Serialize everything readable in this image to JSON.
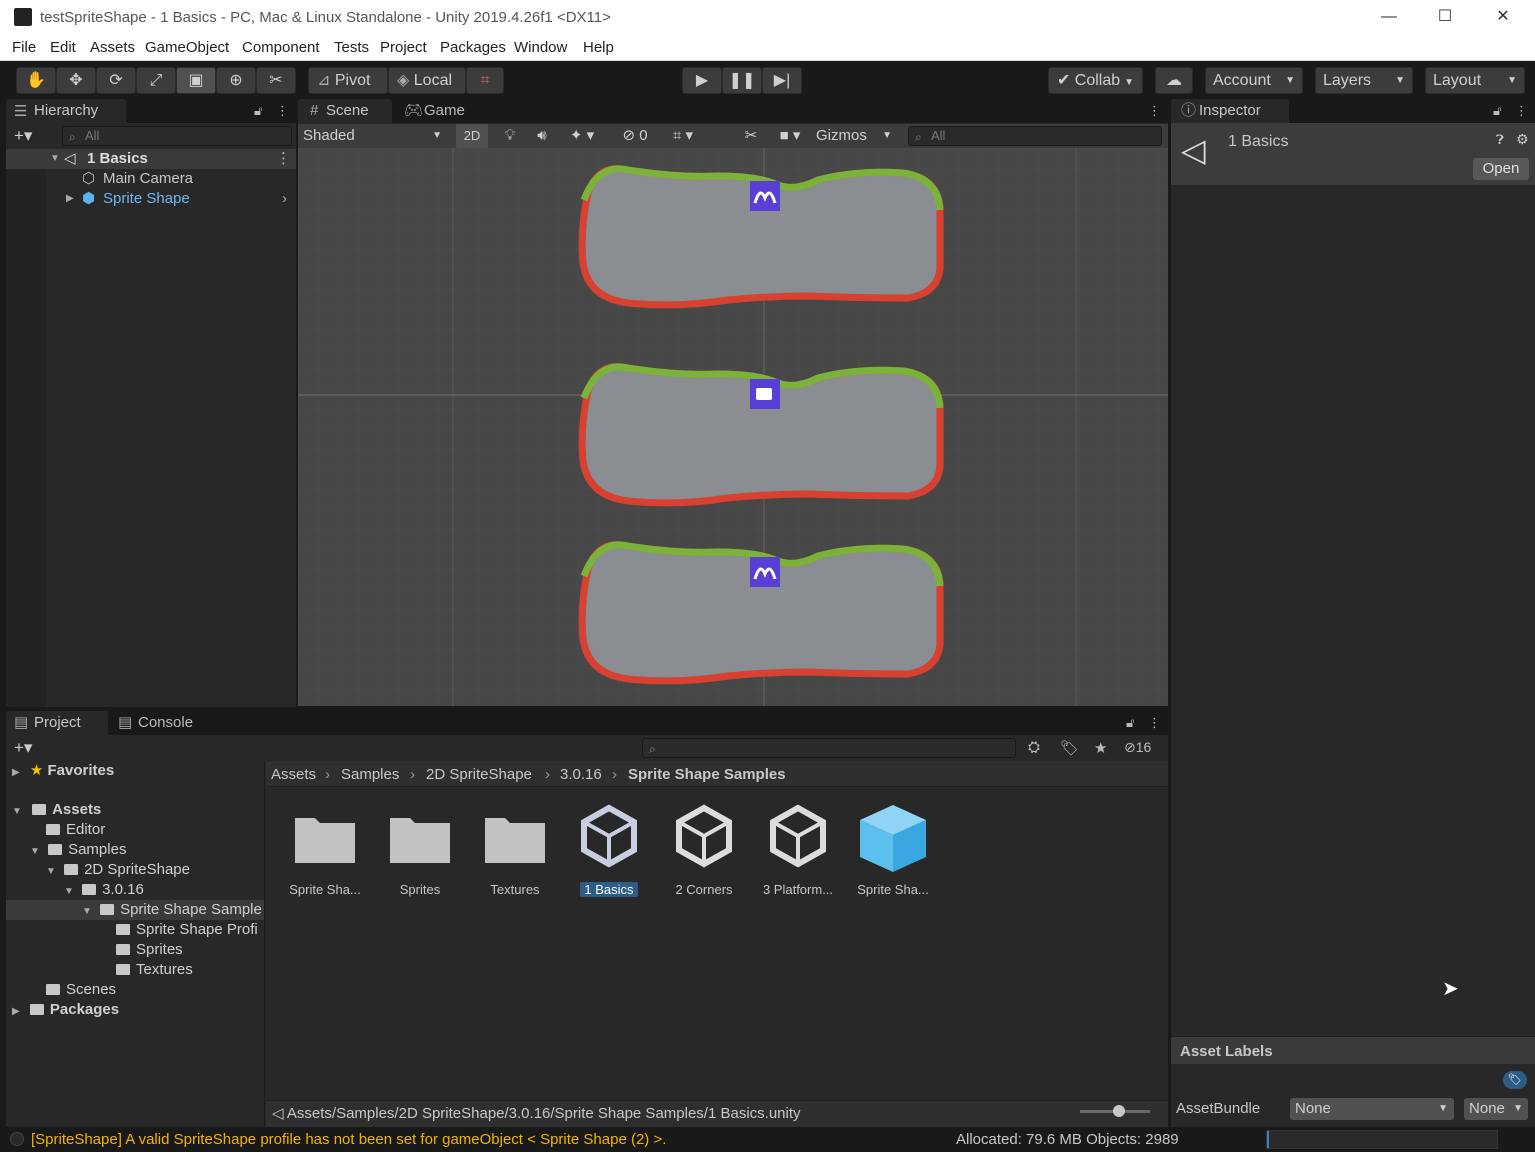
{
  "window": {
    "title": "testSpriteShape - 1 Basics - PC, Mac & Linux Standalone - Unity 2019.4.26f1 <DX11>",
    "controls": {
      "minimize": "—",
      "maximize": "☐",
      "close": "✕"
    }
  },
  "menu": [
    "File",
    "Edit",
    "Assets",
    "GameObject",
    "Component",
    "Tests",
    "Project",
    "Packages",
    "Window",
    "Help"
  ],
  "toolbar": {
    "pivot_label": "Pivot",
    "local_label": "Local",
    "collab_label": "Collab",
    "account_label": "Account",
    "layers_label": "Layers",
    "layout_label": "Layout"
  },
  "hierarchy": {
    "tab_label": "Hierarchy",
    "search_placeholder": "All",
    "scene_name": "1 Basics",
    "items": [
      "Main Camera",
      "Sprite Shape"
    ]
  },
  "scene": {
    "tabs": [
      "Scene",
      "Game"
    ],
    "shading_mode": "Shaded",
    "mode_2d": "2D",
    "hidden_count": "0",
    "gizmos_label": "Gizmos",
    "search_placeholder": "All"
  },
  "inspector": {
    "tab_label": "Inspector",
    "asset_name": "1 Basics",
    "open_button": "Open",
    "asset_labels_title": "Asset Labels",
    "assetbundle_label": "AssetBundle",
    "assetbundle_value": "None",
    "assetbundle_variant": "None"
  },
  "project": {
    "tabs": [
      "Project",
      "Console"
    ],
    "hidden_count": "16",
    "tree": {
      "favorites": "Favorites",
      "assets": "Assets",
      "editor": "Editor",
      "samples": "Samples",
      "spriteshape2d": "2D SpriteShape",
      "version": "3.0.16",
      "sprite_shape_samples": "Sprite Shape Sample",
      "sprite_shape_profiles": "Sprite Shape Profi",
      "sprites": "Sprites",
      "textures": "Textures",
      "scenes": "Scenes",
      "packages": "Packages"
    },
    "breadcrumb": [
      "Assets",
      "Samples",
      "2D SpriteShape",
      "3.0.16",
      "Sprite Shape Samples"
    ],
    "assets": [
      {
        "label": "Sprite Sha...",
        "kind": "folder"
      },
      {
        "label": "Sprites",
        "kind": "folder"
      },
      {
        "label": "Textures",
        "kind": "folder"
      },
      {
        "label": "1 Basics",
        "kind": "unity-scene",
        "selected": true
      },
      {
        "label": "2 Corners",
        "kind": "unity-scene"
      },
      {
        "label": "3 Platform...",
        "kind": "unity-scene"
      },
      {
        "label": "Sprite Sha...",
        "kind": "prefab-cube"
      }
    ],
    "path": "Assets/Samples/2D SpriteShape/3.0.16/Sprite Shape Samples/1 Basics.unity"
  },
  "status": {
    "message": "[SpriteShape] A valid SpriteShape profile has not been set for gameObject < Sprite Shape (2) >.",
    "allocated": "Allocated: 79.6 MB Objects: 2989"
  },
  "colors": {
    "accent_blue": "#2c5d87",
    "shape_top": "#7bb33a",
    "shape_bottom": "#d8402f",
    "shape_fill": "#8a8d91",
    "icon_purple": "#5a3fd6",
    "warning_text": "#f0b400"
  }
}
